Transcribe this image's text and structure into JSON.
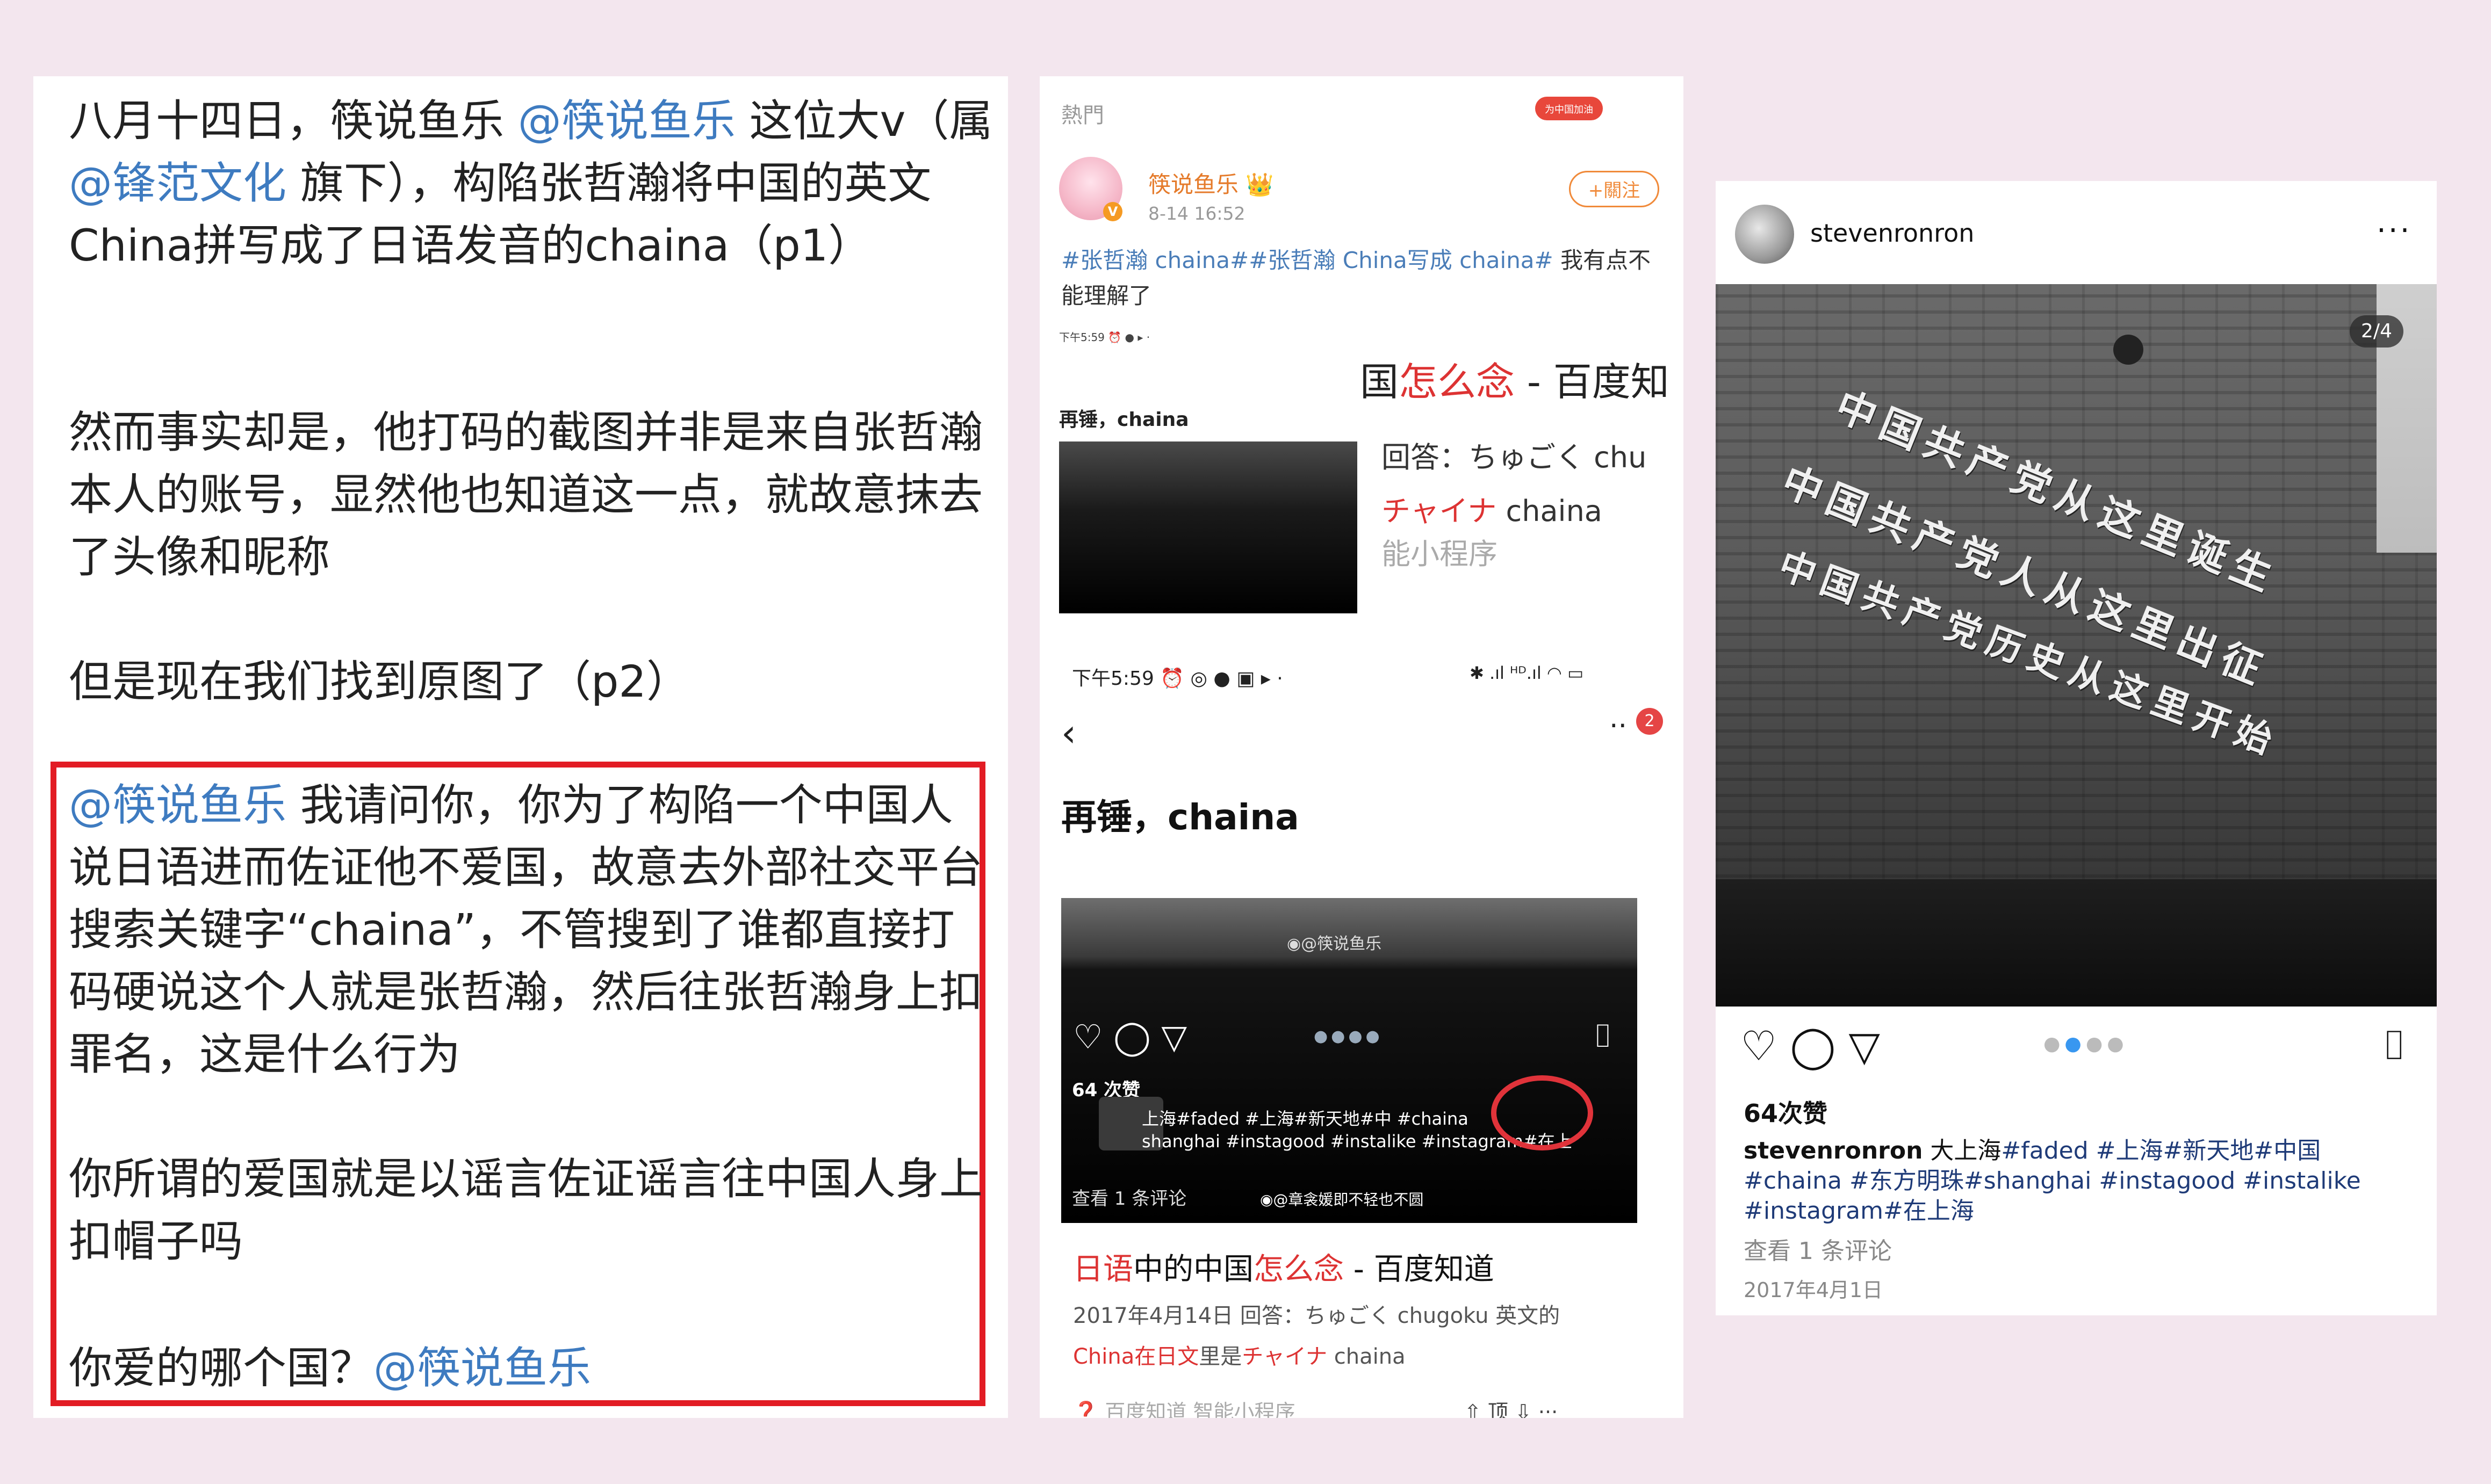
{
  "left": {
    "para1_a": "八月十四日，筷说鱼乐 ",
    "mention1": "@筷说鱼乐",
    "para1_b": " 这位大v（属",
    "mention2": "@锋范文化",
    "para1_c": " 旗下），构陷张哲瀚将中国的英文China拼写成了日语发音的chaina（p1）",
    "para2": "然而事实却是，他打码的截图并非是来自张哲瀚本人的账号，显然他也知道这一点，就故意抹去了头像和昵称",
    "para3": "但是现在我们找到原图了（p2）",
    "boxed_mention": "@筷说鱼乐",
    "boxed_text": " 我请问你，你为了构陷一个中国人说日语进而佐证他不爱国，故意去外部社交平台搜索关键字“chaina”，不管搜到了谁都直接打码硬说这个人就是张哲瀚，然后往张哲瀚身上扣罪名，这是什么行为",
    "para5": "你所谓的爱国就是以谣言佐证谣言往中国人身上扣帽子吗",
    "para6": "你爱的哪个国？",
    "para6_mention": "@筷说鱼乐"
  },
  "weibo": {
    "hot_label": "熱門",
    "hot_logo_text": "为中国加油",
    "username": "筷说鱼乐",
    "crown": "👑",
    "time": "8-14 16:52",
    "follow_label": "+關注",
    "tags": "#张哲瀚 chaina##张哲瀚 China写成 chaina#",
    "post_text": " 我有点不能理解了",
    "mini_status": "下午5:59 ⏰ ●  ▸ ·",
    "mini_title_prefix": "国",
    "mini_title_red": "怎么念",
    "mini_title_suffix": " - 百度知",
    "mini_heading": "再锤，chaina",
    "mini_answer1": "回答：ちゅごく    chu",
    "mini_answer2_red": "チャイナ",
    "mini_answer2_rest": "   chaina",
    "mini_prog": "能小程序",
    "phone_time": "下午5:59 ⏰ ◎ ● ▣ ▸ ·",
    "phone_right": "✱ .ıl ᴴᴰ.ıl ◠ ▭",
    "notif_count": "2",
    "post_title": "再锤，chaina",
    "watermark": "◉@筷说鱼乐",
    "likes": "64 次赞",
    "caption1": "上海#faded #上海#新天地#中  #chaina",
    "caption2": "shanghai #instagood #instalike #instagram#在上",
    "view_comments": "查看 1 条评论",
    "watermark2": "◉@章衾媛即不轻也不圆",
    "baidu_title_red1": "日语",
    "baidu_title_mid1": "中的中国",
    "baidu_title_red2": "怎么念",
    "baidu_title_rest": " - 百度知道",
    "baidu_meta1": "2017年4月14日  回答：ちゅごく    chugoku 英文的",
    "baidu_meta2_a": "China在",
    "baidu_meta2_red": "日文",
    "baidu_meta2_b": "里是",
    "baidu_meta2_red2": "チャイナ",
    "baidu_meta2_c": "   chaina",
    "baidu_foot": "百度知道  智能小程序",
    "baidu_foot_r": "⇧ 顶   ⇩    ···"
  },
  "instagram": {
    "username": "stevenronron",
    "more": "···",
    "counter": "2/4",
    "sign1": "中国共产党从这里诞生",
    "sign2": "中国共产党人从这里出征",
    "sign3": "中国共产党历史从这里开始",
    "likes": "64次赞",
    "cap_user": "stevenronron",
    "cap_text": " 大上海",
    "cap_tags": "#faded #上海#新天地#中国 #chaina #东方明珠#shanghai #instagood #instalike #instagram#在上海",
    "view_comments": "查看 1 条评论",
    "date": "2017年4月1日"
  }
}
